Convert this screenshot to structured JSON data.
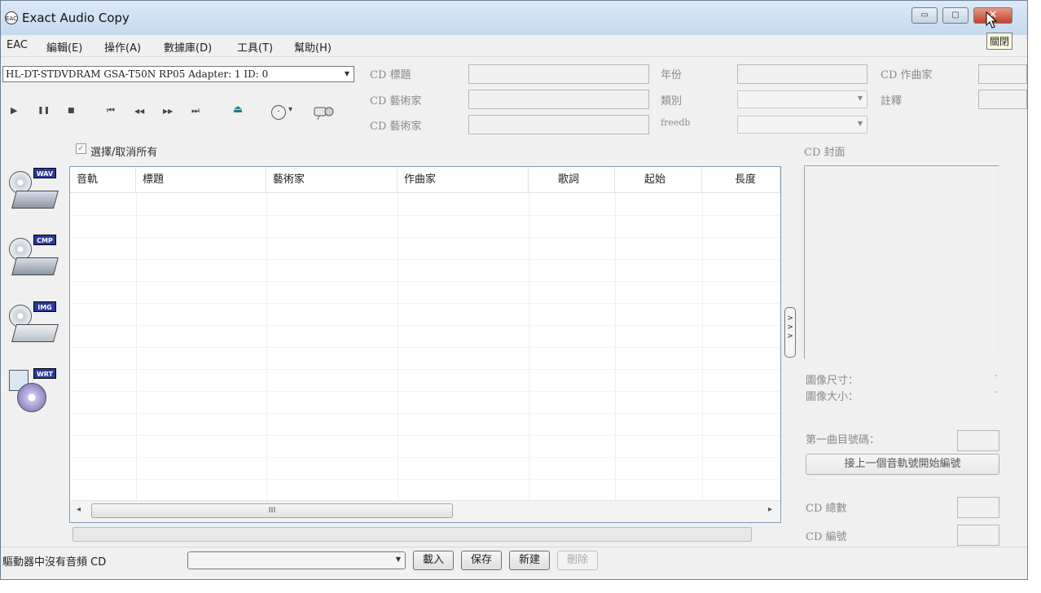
{
  "window": {
    "title": "Exact Audio Copy",
    "app_icon_text": "EAC",
    "minimize_glyph": "▭",
    "maximize_glyph": "▢",
    "close_glyph": "✕",
    "close_tooltip": "關閉"
  },
  "menu": {
    "items": [
      {
        "label": "EAC"
      },
      {
        "label": "編輯(E)"
      },
      {
        "label": "操作(A)"
      },
      {
        "label": "數據庫(D)"
      },
      {
        "label": "工具(T)"
      },
      {
        "label": "幫助(H)"
      }
    ]
  },
  "drive": {
    "selected": "HL-DT-STDVDRAM GSA-T50N RP05  Adapter: 1  ID: 0"
  },
  "controls": {
    "play": "▶",
    "pause": "❚❚",
    "stop": "■",
    "prev_track": "⏮",
    "rewind": "◀◀",
    "fast_forward": "▶▶",
    "next_track": "⏭",
    "eject": "⏏",
    "menu_arrow": "▾"
  },
  "metadata": {
    "cd_title_label": "CD 標題",
    "cd_artist_label": "CD 藝術家",
    "cd_artist2_label": "CD 藝術家",
    "year_label": "年份",
    "genre_label": "類別",
    "freedb_label": "freedb",
    "composer_label": "CD 作曲家",
    "comment_label": "註釋"
  },
  "select_all": {
    "label": "選擇/取消所有",
    "checked": true
  },
  "side_buttons": [
    {
      "badge": "WAV"
    },
    {
      "badge": "CMP"
    },
    {
      "badge": "IMG"
    },
    {
      "badge": "WRT"
    }
  ],
  "track_list": {
    "columns": [
      "音軌",
      "標題",
      "藝術家",
      "作曲家",
      "歌詞",
      "起始",
      "長度"
    ],
    "rows": [],
    "scroll_grip": "III",
    "scroll_left": "◂",
    "scroll_right": "▸"
  },
  "cover": {
    "label": "CD 封面",
    "expander": ">\n>\n>",
    "image_size_label": "圖像尺寸：",
    "image_filesize_label": "圖像大小：",
    "image_size_value": "-",
    "image_filesize_value": "-"
  },
  "numbering": {
    "first_track_label": "第一曲目號碼：",
    "continue_button": "接上一個音軌號開始編號",
    "cd_count_label": "CD 總數",
    "cd_number_label": "CD 編號"
  },
  "status": {
    "message": "驅動器中沒有音頻 CD"
  },
  "buttons": {
    "load": "載入",
    "save": "保存",
    "new": "新建",
    "delete": "刪除"
  }
}
